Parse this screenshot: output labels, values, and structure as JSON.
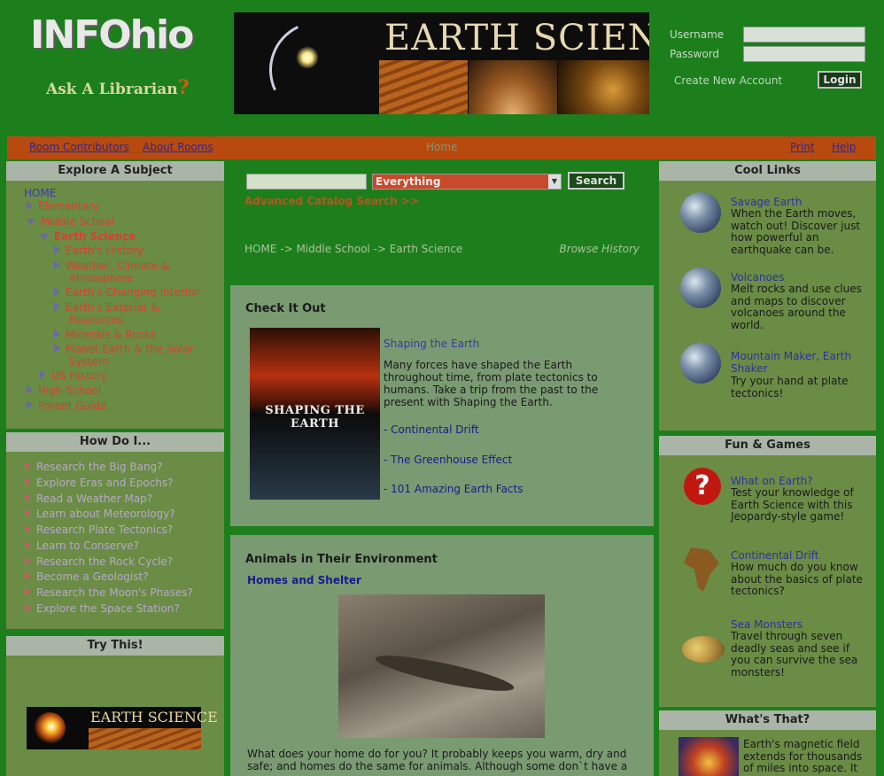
{
  "header": {
    "logo_text": "INFOhio",
    "ask_librarian": "Ask A Librarian",
    "ask_mark": "?",
    "banner_title": "EARTH SCIENCE"
  },
  "login": {
    "username_label": "Username",
    "password_label": "Password",
    "create_account": "Create New Account",
    "login_button": "Login"
  },
  "navbar": {
    "room_contributors": "Room Contributors",
    "about_rooms": "About Rooms",
    "home": "Home",
    "print": "Print",
    "help": "Help"
  },
  "explore": {
    "title": "Explore A Subject",
    "home": "HOME",
    "elementary": "Elementary",
    "middle_school": "Middle School",
    "earth_science": "Earth Science",
    "earth_topics": [
      "Earth's History",
      "Weather, Climate &",
      "Atmosphere",
      "Earth's Changing Interior",
      "Earth's Exterior &",
      "Resources",
      "Minerals & Rocks",
      "Planet Earth & the Solar",
      "System"
    ],
    "us_history": "US History",
    "high_school": "High School",
    "parent_guide": "Parent Guide"
  },
  "howdo": {
    "title": "How Do I...",
    "items": [
      "Research the Big Bang?",
      "Explore Eras and Epochs?",
      "Read a Weather Map?",
      "Learn about Meteorology?",
      "Research Plate Tectonics?",
      "Learn to Conserve?",
      "Research the Rock Cycle?",
      "Become a Geologist?",
      "Research the Moon's Phases?",
      "Explore the Space Station?"
    ]
  },
  "try_this": {
    "title": "Try This!",
    "image_text": "EARTH SCIENCE"
  },
  "search": {
    "input_value": "",
    "scope": "Everything",
    "button": "Search",
    "advanced": "Advanced Catalog Search >>"
  },
  "breadcrumb": {
    "home": "HOME",
    "sep": "->",
    "middle": "Middle School",
    "current": "Earth Science",
    "browse_history": "Browse History"
  },
  "check_it_out": {
    "title": "Check It Out",
    "image_title": "SHAPING THE EARTH",
    "link": "Shaping the Earth",
    "desc": "Many forces have shaped the Earth throughout time, from plate tectonics to humans. Take a trip from the past to the present with Shaping the Earth.",
    "subs": [
      "- Continental Drift",
      "- The Greenhouse Effect",
      "- 101 Amazing Earth Facts"
    ]
  },
  "animals": {
    "title": "Animals in Their Environment",
    "subtitle": "Homes and Shelter",
    "text": "What does your home do for you? It probably keeps you warm, dry and safe; and homes do the same for animals. Although some don`t have a"
  },
  "cool_links": {
    "title": "Cool Links",
    "items": [
      {
        "title": "Savage Earth",
        "desc": "When the Earth moves, watch out! Discover just how powerful an earthquake can be."
      },
      {
        "title": "Volcanoes",
        "desc": "Melt rocks and use clues and maps to discover volcanoes around the world."
      },
      {
        "title": "Mountain Maker, Earth Shaker",
        "desc": "Try your hand at plate tectonics!"
      }
    ]
  },
  "fun_games": {
    "title": "Fun & Games",
    "items": [
      {
        "title": "What on Earth?",
        "desc": "Test your knowledge of Earth Science with this Jeopardy-style game!"
      },
      {
        "title": "Continental Drift",
        "desc": "How much do you know about the basics of plate tectonics?"
      },
      {
        "title": "Sea Monsters",
        "desc": "Travel through seven deadly seas and see if you can survive the sea monsters!"
      }
    ]
  },
  "whats_that": {
    "title": "What's That?",
    "text": "Earth's magnetic field extends for thousands of miles into space. It"
  }
}
